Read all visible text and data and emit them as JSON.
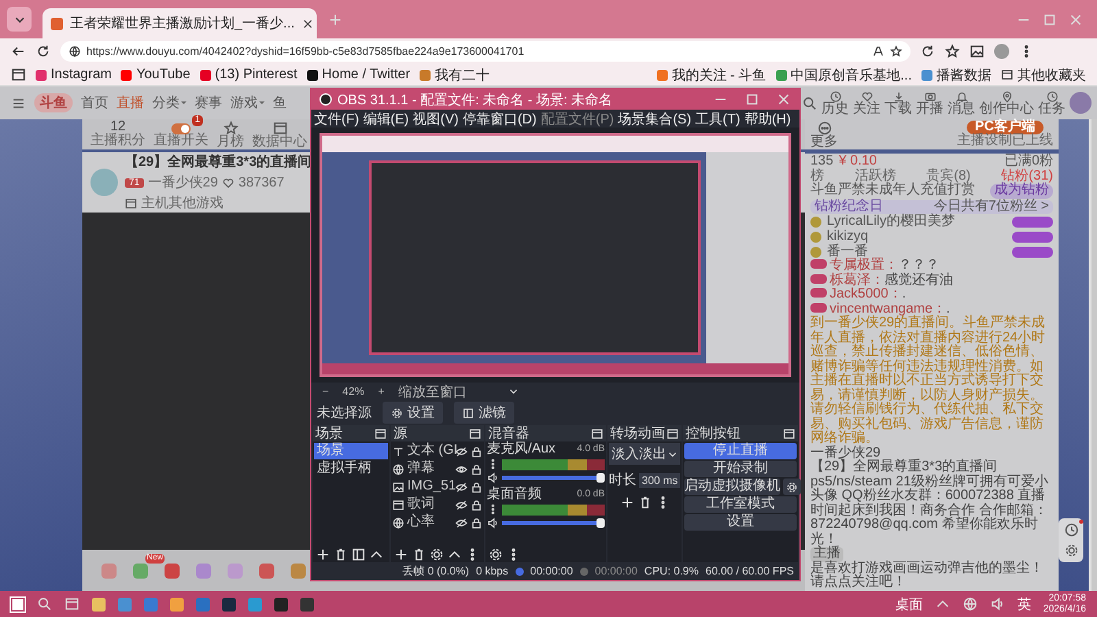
{
  "browser": {
    "tab_title": "王者荣耀世界主播激励计划_一番少...",
    "url": "https://www.douyu.com/4042402?dyshid=16f59bb-c5e83d7585fbae224a9e173600041701",
    "bookmarks": [
      {
        "label": "Instagram",
        "color": "#e1306c"
      },
      {
        "label": "YouTube",
        "color": "#ff0000"
      },
      {
        "label": "(13) Pinterest",
        "color": "#e60023"
      },
      {
        "label": "Home / Twitter",
        "color": "#111111"
      },
      {
        "label": "我有二十",
        "color": "#c87a2a"
      }
    ],
    "right_bookmarks": [
      {
        "label": "我的关注 - 斗鱼",
        "color": "#f07020"
      },
      {
        "label": "中国原创音乐基地...",
        "color": "#3aa050"
      },
      {
        "label": "播酱数据",
        "color": "#4a90d0"
      }
    ],
    "other_bookmarks": "其他收藏夹"
  },
  "site": {
    "logo": "斗鱼",
    "nav": [
      {
        "label": "首页",
        "selected": false,
        "dropdown": false
      },
      {
        "label": "直播",
        "selected": true,
        "dropdown": false
      },
      {
        "label": "分类",
        "selected": false,
        "dropdown": true
      },
      {
        "label": "赛事",
        "selected": false,
        "dropdown": false
      },
      {
        "label": "游戏",
        "selected": false,
        "dropdown": true
      },
      {
        "label": "鱼",
        "selected": false,
        "dropdown": false
      }
    ],
    "user_menu": [
      {
        "label": "历史",
        "kind": "clock"
      },
      {
        "label": "关注",
        "kind": "heart"
      },
      {
        "label": "下载",
        "kind": "download"
      },
      {
        "label": "开播",
        "kind": "camera"
      },
      {
        "label": "消息",
        "kind": "bell"
      },
      {
        "label": "创作中心",
        "kind": "pin"
      },
      {
        "label": "任务",
        "kind": "clock"
      }
    ],
    "stats": [
      {
        "kind": "score",
        "value": "12",
        "label": "主播积分"
      },
      {
        "kind": "toggle",
        "label": "直播开关",
        "badge": "1",
        "on": true
      },
      {
        "kind": "medal",
        "label": "月榜"
      },
      {
        "kind": "screen",
        "label": "数据中心"
      }
    ],
    "room": {
      "title": "【29】全网最尊重3*3的直播间",
      "level": "71",
      "streamer": "一番少侠29",
      "hot": "387367",
      "category": "主机其他游戏"
    },
    "gift_badge": "New",
    "side": {
      "more": "更多",
      "client": "PC客户端",
      "note": "主播设制已上线"
    },
    "chat": {
      "count": "135",
      "money": "¥ 0.10",
      "state": "已满0粉",
      "tabs": [
        {
          "label": "榜",
          "selected": false
        },
        {
          "label": "活跃榜",
          "selected": false
        },
        {
          "label": "贵宾(8)",
          "selected": false
        },
        {
          "label": "钻粉(31)",
          "selected": true
        }
      ],
      "notice": "斗鱼严禁未成年人充值打赏",
      "join": "成为钻粉",
      "anniversary": "钻粉纪念日",
      "anniversary_count": "今日共有7位粉丝 >",
      "fans": [
        "LyricalLily的樱田美梦",
        "kikizyq",
        "番一番"
      ],
      "messages": [
        {
          "user": "专属极置：",
          "text": "？？？"
        },
        {
          "user": "栎葛泽：",
          "text": "感觉还有油"
        },
        {
          "user": "Jack5000：",
          "text": "."
        },
        {
          "user": "vincentwangame：",
          "text": "."
        }
      ],
      "system": "到一番少侠29的直播间。斗鱼严禁未成年人直播，依法对直播内容进行24小时巡查，禁止传播封建迷信、低俗色情、赌博诈骗等任何违法违规理性消费。如主播在直播时以不正当方式诱导打下交易，请谨慎判断，以防人身财产损失。请勿轻信刷钱行为、代练代抽、私下交易、购买礼包码、游戏广告信息，谨防网络诈骗。",
      "streamer": "一番少侠29",
      "room_title": "【29】全网最尊重3*3的直播间",
      "description": "ps5/ns/steam 21级粉丝牌可拥有可爱小头像 QQ粉丝水友群：600072388 直播时间起床到我困！商务合作 合作邮箱：872240798@qq.com 希望你能欢乐时光！",
      "host_label": "主播",
      "host_message": "是喜欢打游戏画画运动弹吉他的墨尘！请点点关注吧！"
    }
  },
  "obs": {
    "title": "OBS 31.1.1 - 配置文件: 未命名 - 场景: 未命名",
    "menu": [
      {
        "label": "文件(F)",
        "disabled": false
      },
      {
        "label": "编辑(E)",
        "disabled": false
      },
      {
        "label": "视图(V)",
        "disabled": false
      },
      {
        "label": "停靠窗口(D)",
        "disabled": false
      },
      {
        "label": "配置文件(P)",
        "disabled": true
      },
      {
        "label": "场景集合(S)",
        "disabled": false
      },
      {
        "label": "工具(T)",
        "disabled": false
      },
      {
        "label": "帮助(H)",
        "disabled": false
      }
    ],
    "zoom": {
      "minus": "−",
      "value": "42%",
      "plus": "+",
      "mode": "缩放至窗口"
    },
    "no_source": "未选择源",
    "settings_button": "设置",
    "filters_button": "滤镜",
    "scenes": {
      "title": "场景",
      "items": [
        {
          "label": "场景",
          "selected": true
        },
        {
          "label": "虚拟手柄",
          "selected": false
        }
      ]
    },
    "sources": {
      "title": "源",
      "items": [
        {
          "label": "文本 (GI",
          "kind": "text",
          "visible": false,
          "locked": true
        },
        {
          "label": "弹幕",
          "kind": "browser",
          "visible": true,
          "locked": true
        },
        {
          "label": "IMG_51",
          "kind": "image",
          "visible": false,
          "locked": true
        },
        {
          "label": "歌词",
          "kind": "window",
          "visible": false,
          "locked": true
        },
        {
          "label": "心率",
          "kind": "browser",
          "visible": false,
          "locked": true
        }
      ]
    },
    "mixer": {
      "title": "混音器",
      "channels": [
        {
          "name": "麦克风/Aux",
          "reading": "4.0 dB",
          "level": 1
        },
        {
          "name": "桌面音频",
          "reading": "0.0 dB",
          "level": 1
        }
      ]
    },
    "transitions": {
      "title": "转场动画",
      "current": "淡入淡出",
      "duration_label": "时长",
      "duration": "300 ms"
    },
    "controls": {
      "title": "控制按钮",
      "buttons": [
        {
          "label": "停止直播",
          "active": true,
          "gear": false
        },
        {
          "label": "开始录制",
          "active": false,
          "gear": false
        },
        {
          "label": "启动虚拟摄像机",
          "active": false,
          "gear": true
        },
        {
          "label": "工作室模式",
          "active": false,
          "gear": false
        },
        {
          "label": "设置",
          "active": false,
          "gear": false
        }
      ]
    },
    "status": {
      "dropped": "丢帧 0 (0.0%)",
      "bitrate": "0 kbps",
      "stream_time": "00:00:00",
      "record_time": "00:00:00",
      "cpu": "CPU: 0.9%",
      "fps": "60.00 / 60.00 FPS"
    }
  },
  "taskbar": {
    "desktop": "桌面",
    "ime": "英",
    "time": "20:07:58",
    "date": "2026/4/16"
  }
}
